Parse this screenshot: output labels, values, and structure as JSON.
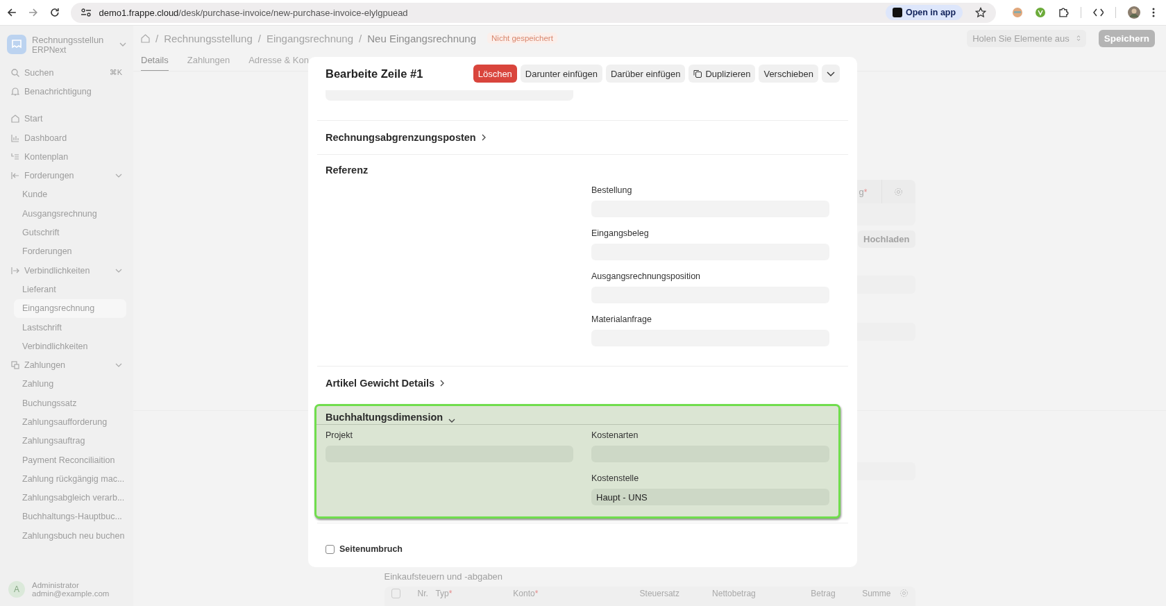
{
  "browser": {
    "url_host": "demo1.frappe.cloud",
    "url_path": "/desk/purchase-invoice/new-purchase-invoice-elylgpuead",
    "open_in_app": "Open in app"
  },
  "sidebar": {
    "app_title": "Rechnungsstellun",
    "app_subtitle": "ERPNext",
    "search": {
      "placeholder": "Suchen",
      "shortcut": "⌘K"
    },
    "notifications": "Benachrichtigung",
    "items": [
      {
        "label": "Start"
      },
      {
        "label": "Dashboard"
      },
      {
        "label": "Kontenplan"
      },
      {
        "label": "Forderungen",
        "expanded": true,
        "children": [
          {
            "label": "Kunde",
            "selected": false
          },
          {
            "label": "Ausgangsrechnung",
            "selected": false
          },
          {
            "label": "Gutschrift",
            "selected": false
          },
          {
            "label": "Forderungen",
            "selected": false
          }
        ]
      },
      {
        "label": "Verbindlichkeiten",
        "expanded": true,
        "children": [
          {
            "label": "Lieferant",
            "selected": false
          },
          {
            "label": "Eingangsrechnung",
            "selected": true
          },
          {
            "label": "Lastschrift",
            "selected": false
          },
          {
            "label": "Verbindlichkeiten",
            "selected": false
          }
        ]
      },
      {
        "label": "Zahlungen",
        "expanded": true,
        "children": [
          {
            "label": "Zahlung",
            "selected": false
          },
          {
            "label": "Buchungssatz",
            "selected": false
          },
          {
            "label": "Zahlungsaufforderung",
            "selected": false
          },
          {
            "label": "Zahlungsauftrag",
            "selected": false
          },
          {
            "label": "Payment Reconciliaition",
            "selected": false
          },
          {
            "label": "Zahlung rückgängig mac...",
            "selected": false
          },
          {
            "label": "Zahlungsabgleich verarb...",
            "selected": false
          },
          {
            "label": "Buchhaltungs-Hauptbuc...",
            "selected": false
          },
          {
            "label": "Zahlungsbuch neu buchen",
            "selected": false
          }
        ]
      }
    ],
    "user": {
      "initial": "A",
      "name": "Administrator",
      "email": "admin@example.com"
    }
  },
  "header": {
    "breadcrumb_separator": "/",
    "breadcrumbs": [
      "Rechnungsstellung",
      "Eingangsrechnung",
      "Neu Eingangsrechnung"
    ],
    "status": "Nicht gespeichert",
    "fetch_select": "Holen Sie Elemente aus",
    "save_button": "Speichern"
  },
  "tabs": [
    {
      "label": "Details",
      "selected": true
    },
    {
      "label": "Zahlungen",
      "selected": false
    },
    {
      "label": "Adresse & Kon",
      "selected": false
    }
  ],
  "form": {
    "required_mark": "*",
    "grid_label": "g",
    "grid_required": true,
    "upload_button": "Hochladen",
    "taxes_title": "Einkaufsteuern und -abgaben",
    "taxes_select_all_checked": false,
    "taxes_columns": [
      {
        "label": "Nr.",
        "required": false
      },
      {
        "label": "Typ",
        "required": true
      },
      {
        "label": "Konto",
        "required": true
      },
      {
        "label": "Steuersatz",
        "required": false
      },
      {
        "label": "Nettobetrag",
        "required": false
      },
      {
        "label": "Betrag",
        "required": false
      },
      {
        "label": "Summe",
        "required": false
      }
    ]
  },
  "modal": {
    "title": "Bearbeite Zeile #1",
    "actions": [
      {
        "label": "Löschen",
        "kind": "danger"
      },
      {
        "label": "Darunter einfügen",
        "kind": "plain"
      },
      {
        "label": "Darüber einfügen",
        "kind": "plain"
      },
      {
        "label": "Duplizieren",
        "kind": "copy"
      },
      {
        "label": "Verschieben",
        "kind": "plain"
      }
    ],
    "sections": [
      {
        "title": "Rechnungsabgrenzungsposten",
        "kind": "collapsible",
        "expanded": false,
        "highlighted": false
      },
      {
        "title": "Referenz",
        "kind": "static",
        "highlighted": false,
        "right": [
          {
            "label": "Bestellung"
          },
          {
            "label": "Eingangsbeleg"
          },
          {
            "label": "Ausgangsrechnungsposition"
          },
          {
            "label": "Materialanfrage"
          }
        ]
      },
      {
        "title": "Artikel Gewicht Details",
        "kind": "collapsible",
        "expanded": false,
        "highlighted": false
      },
      {
        "title": "Buchhaltungsdimension",
        "kind": "collapsible",
        "expanded": true,
        "highlighted": true,
        "left": [
          {
            "label": "Projekt"
          }
        ],
        "right": [
          {
            "label": "Kostenarten"
          },
          {
            "label": "Kostenstelle",
            "value": "Haupt - UNS"
          }
        ]
      }
    ],
    "checkbox": {
      "label": "Seitenumbruch",
      "checked": false
    }
  }
}
